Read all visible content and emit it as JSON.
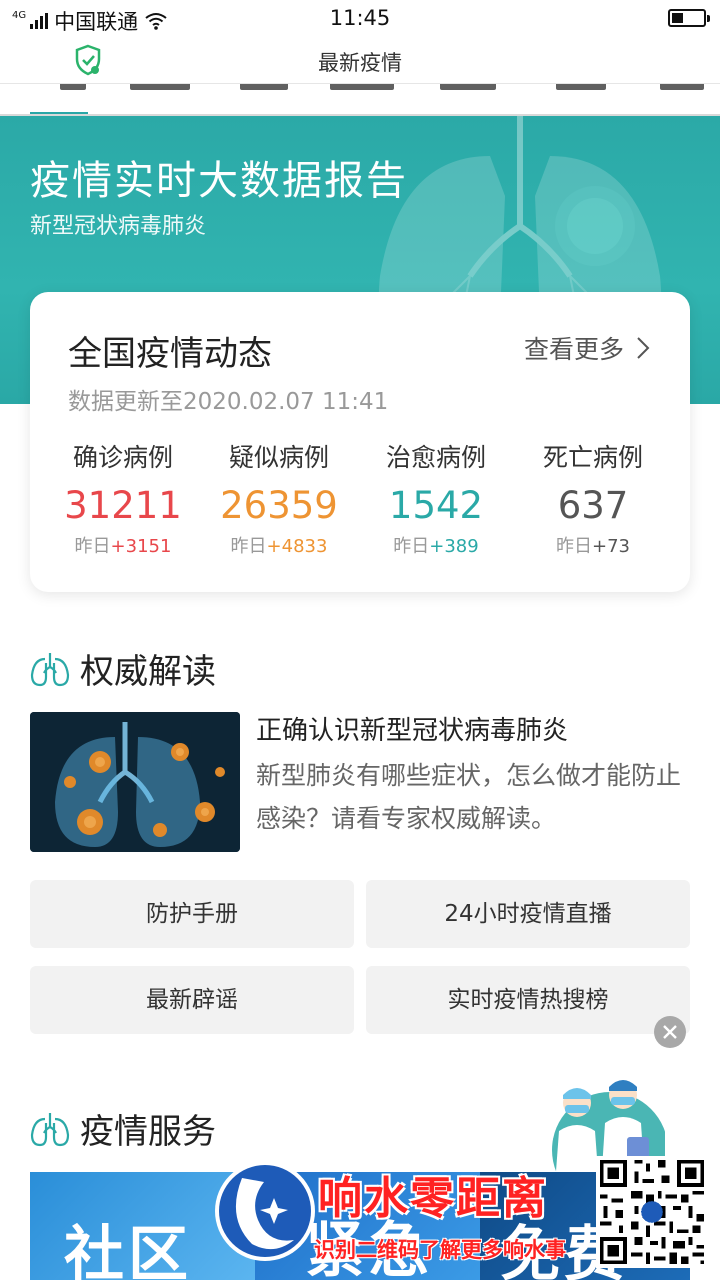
{
  "status_bar": {
    "network_label": "4G",
    "carrier": "中国联通",
    "time": "11:45",
    "battery_level": 0.35
  },
  "title_bar": {
    "title": "最新疫情",
    "left_icon": "shield-check-icon"
  },
  "hero": {
    "title": "疫情实时大数据报告",
    "subtitle": "新型冠状病毒肺炎"
  },
  "national_stats": {
    "title": "全国疫情动态",
    "more_label": "查看更多",
    "updated": "数据更新至2020.02.07 11:41",
    "items": [
      {
        "label": "确诊病例",
        "value": "31211",
        "delta_prefix": "昨日",
        "delta": "+3151",
        "color": "#e8474b"
      },
      {
        "label": "疑似病例",
        "value": "26359",
        "delta_prefix": "昨日",
        "delta": "+4833",
        "color": "#ee9433"
      },
      {
        "label": "治愈病例",
        "value": "1542",
        "delta_prefix": "昨日",
        "delta": "+389",
        "color": "#2aa9a7"
      },
      {
        "label": "死亡病例",
        "value": "637",
        "delta_prefix": "昨日",
        "delta": "+73",
        "color": "#555555"
      }
    ]
  },
  "authority": {
    "section_title": "权威解读",
    "article": {
      "title": "正确认识新型冠状病毒肺炎",
      "description": "新型肺炎有哪些症状，怎么做才能防止感染？请看专家权威解读。"
    },
    "buttons": [
      {
        "label": "防护手册"
      },
      {
        "label": "24小时疫情直播"
      },
      {
        "label": "最新辟谣"
      },
      {
        "label": "实时疫情热搜榜"
      }
    ]
  },
  "services": {
    "section_title": "疫情服务",
    "banners": [
      {
        "label": "社区"
      },
      {
        "label": "紧急"
      },
      {
        "label": "免费"
      }
    ]
  },
  "watermark": {
    "title": "响水零距离",
    "subtitle": "识别二维码了解更多响水事"
  }
}
